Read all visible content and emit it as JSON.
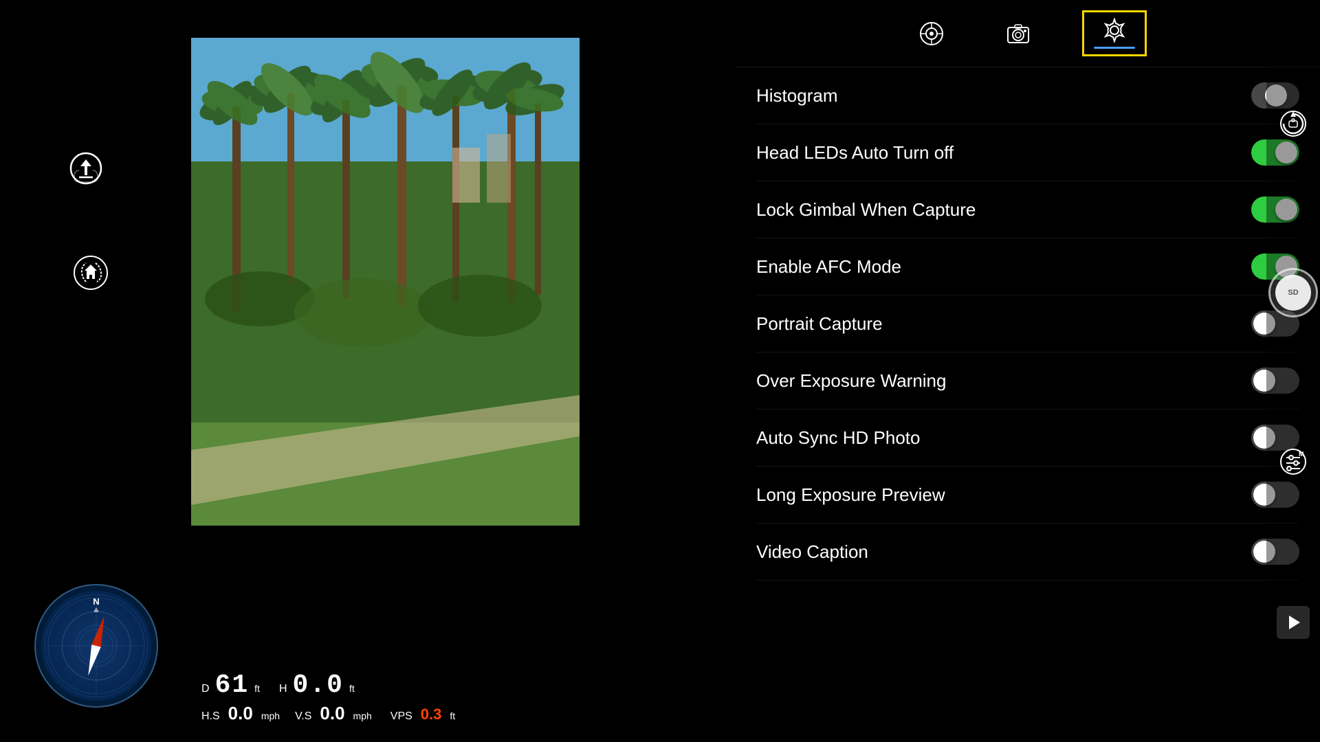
{
  "tabs": [
    {
      "id": "photo-mode",
      "icon": "📷",
      "active": false
    },
    {
      "id": "camera",
      "icon": "📸",
      "active": false
    },
    {
      "id": "settings",
      "icon": "⚙️",
      "active": true
    }
  ],
  "settings": [
    {
      "id": "histogram",
      "label": "Histogram",
      "state": "half"
    },
    {
      "id": "head-leds",
      "label": "Head LEDs Auto Turn off",
      "state": "on"
    },
    {
      "id": "lock-gimbal",
      "label": "Lock Gimbal When Capture",
      "state": "on"
    },
    {
      "id": "enable-afc",
      "label": "Enable AFC Mode",
      "state": "on"
    },
    {
      "id": "portrait-capture",
      "label": "Portrait Capture",
      "state": "off"
    },
    {
      "id": "over-exposure",
      "label": "Over Exposure Warning",
      "state": "off"
    },
    {
      "id": "auto-sync-hd",
      "label": "Auto Sync HD Photo",
      "state": "off"
    },
    {
      "id": "long-exposure",
      "label": "Long Exposure Preview",
      "state": "off"
    },
    {
      "id": "video-caption",
      "label": "Video Caption",
      "state": "off"
    }
  ],
  "telemetry": {
    "distance_label": "D",
    "distance_value": "61",
    "distance_unit": "ft",
    "height_label": "H",
    "height_value": "0.0",
    "height_unit": "ft",
    "hs_label": "H.S",
    "hs_value": "0.0",
    "hs_unit": "mph",
    "vs_label": "V.S",
    "vs_value": "0.0",
    "vs_unit": "mph",
    "vps_label": "VPS",
    "vps_value": "0.3",
    "vps_unit": "ft"
  },
  "compass": {
    "north_label": "N"
  },
  "right_buttons": {
    "rotate_camera": "↻",
    "capture": "SD",
    "settings_m": "⚙",
    "playback": "▶"
  }
}
